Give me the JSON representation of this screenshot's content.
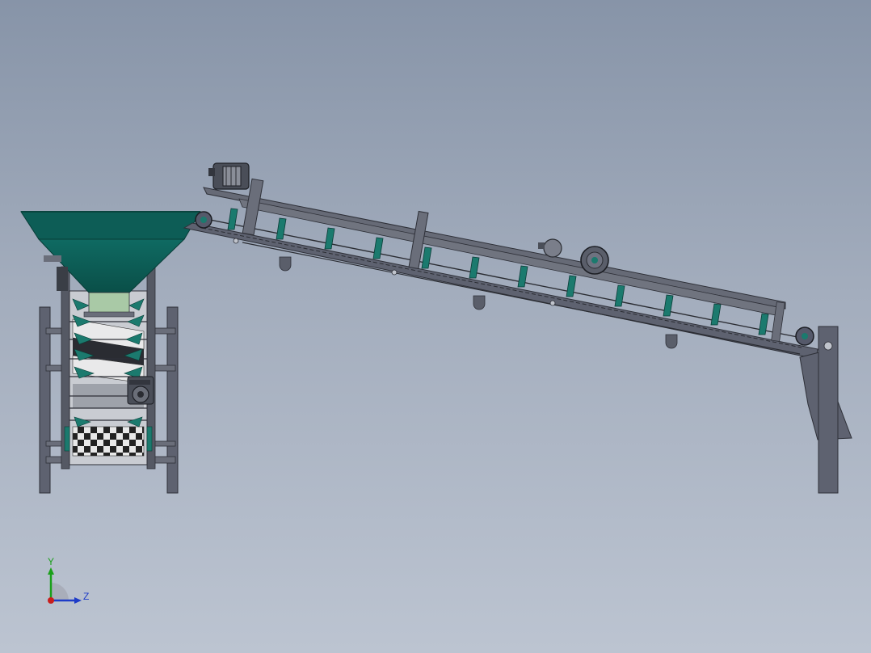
{
  "viewport": {
    "background_top": "#8794a8",
    "background_bottom": "#bcc4d1"
  },
  "model": {
    "description_colors": {
      "frame": "#5e6270",
      "frame_dark": "#3f434e",
      "hopper": "#0f5f58",
      "hopper_dark": "#0a4a44",
      "cleat": "#1b7a6e",
      "motor": "#4a4e58"
    }
  },
  "triad": {
    "y_label": "Y",
    "z_label": "Z",
    "y_color": "#1aa01a",
    "z_color": "#1e3cc8",
    "x_color": "#c81e1e"
  }
}
